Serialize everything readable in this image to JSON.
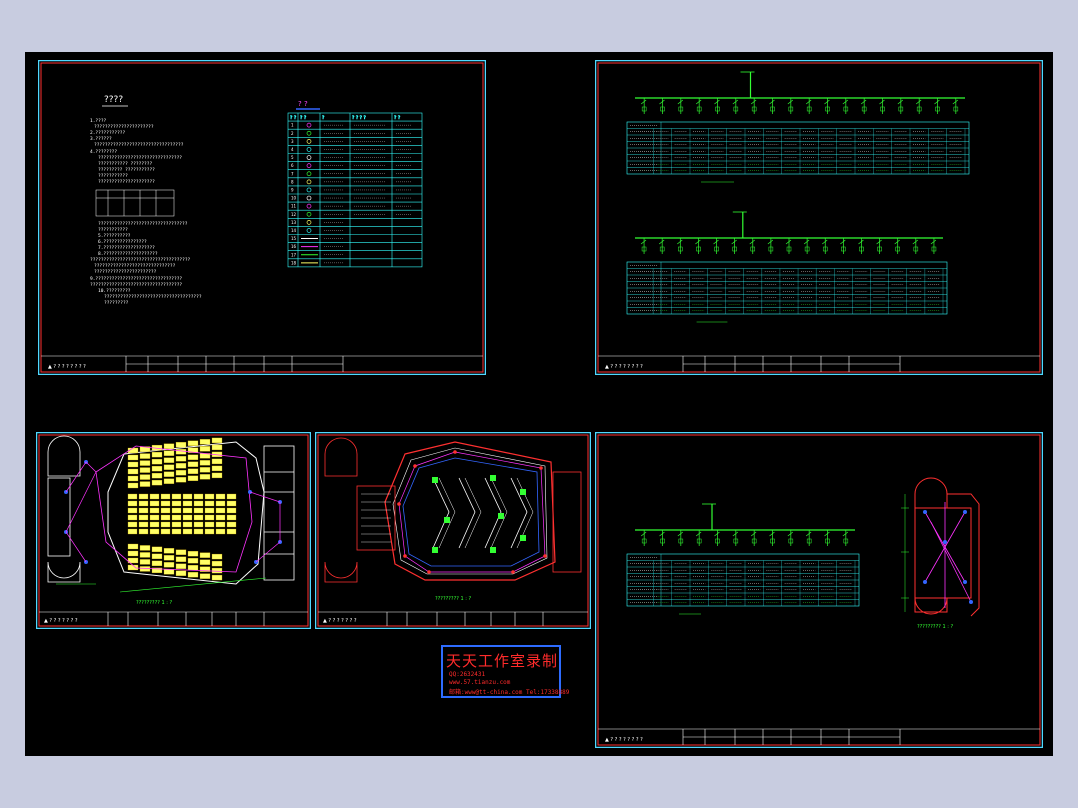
{
  "app": {
    "name": "CAD drawing viewer",
    "colors": {
      "window_bg": "#c8cce0",
      "canvas_bg": "#000000",
      "sheet_border": "#4fd8ff",
      "inner_border": "#ff3030",
      "drawing_green": "#33ff33",
      "drawing_cyan": "#33ffff",
      "seat_yellow": "#ffff66",
      "wire_magenta": "#ff33ff"
    }
  },
  "sheets": [
    {
      "id": "sheet-1",
      "content": "design notes and legend table",
      "title_block": "Title block"
    },
    {
      "id": "sheet-2",
      "content": "distribution system diagrams with load tables"
    },
    {
      "id": "sheet-3",
      "content": "lighting plan of auditorium seating"
    },
    {
      "id": "sheet-4",
      "content": "ceiling lighting plan"
    },
    {
      "id": "sheet-5",
      "content": "distribution system diagram and stair lighting detail"
    }
  ],
  "legend": {
    "title": "? ?",
    "headers": [
      "? ?",
      "? ?",
      "?",
      "? ? ? ?",
      "? ?"
    ]
  },
  "notes": {
    "title": "????"
  },
  "stamp": {
    "title": "天天工作室录制",
    "lines": [
      "QQ:2632431",
      "www.57.tianzu.com",
      "邮箱:www@tt-china.com  Tel:17338889"
    ]
  }
}
